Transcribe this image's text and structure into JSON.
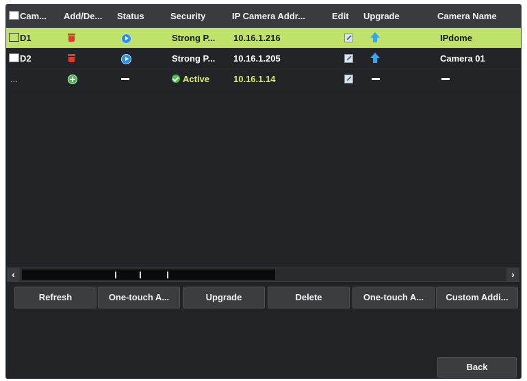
{
  "table": {
    "headers": {
      "camera": "Cam...",
      "add_delete": "Add/De...",
      "status": "Status",
      "security": "Security",
      "ip": "IP Camera Addr...",
      "edit": "Edit",
      "upgrade": "Upgrade",
      "camera_name": "Camera Name"
    },
    "rows": [
      {
        "camera": "D1",
        "security": "Strong P...",
        "ip": "10.16.1.216",
        "camera_name": "IPdome",
        "selected": true
      },
      {
        "camera": "D2",
        "security": "Strong P...",
        "ip": "10.16.1.205",
        "camera_name": "Camera 01",
        "selected": false
      },
      {
        "camera": "...",
        "security": "Active",
        "ip": "10.16.1.14",
        "camera_name": "",
        "selected": false
      }
    ]
  },
  "scrollbar": {
    "left_arrow": "‹",
    "right_arrow": "›"
  },
  "buttons": {
    "refresh": "Refresh",
    "one_touch_1": "One-touch A...",
    "upgrade": "Upgrade",
    "delete": "Delete",
    "one_touch_2": "One-touch A...",
    "custom_add": "Custom Addi...",
    "back": "Back"
  },
  "colors": {
    "selected_row": "#bfe26a",
    "delete_icon": "#e23a2a",
    "status_icon": "#2f8fe0",
    "add_icon": "#43b84a",
    "upgrade_icon": "#35a6f2",
    "active_text": "#d6f06a"
  },
  "icons": [
    "delete-icon",
    "status-play-icon",
    "add-icon",
    "edit-icon",
    "upgrade-icon",
    "active-check-icon"
  ]
}
